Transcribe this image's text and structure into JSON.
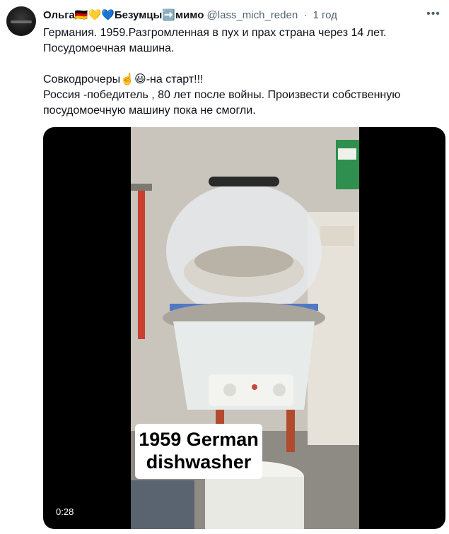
{
  "tweet": {
    "author_name": "Ольга🇩🇪💛💙Безумцы➡️мимо",
    "handle": "@lass_mich_reden",
    "separator": "·",
    "time": "1 год",
    "more_icon": "more-icon",
    "paragraph1_line1": "Германия. 1959.Разгромленная в пух и прах страна через 14 лет.",
    "paragraph1_line2": "Посудомоечная машина.",
    "paragraph2_line1": "Совкодрочеры☝️😃-на старт!!!",
    "paragraph2_line2": "Россия -победитель , 80 лет после войны. Произвести собственную",
    "paragraph2_line3": "посудомоечную машину пока не смогли."
  },
  "media": {
    "caption_line1": "1959 German",
    "caption_line2": "dishwasher",
    "duration": "0:28"
  }
}
